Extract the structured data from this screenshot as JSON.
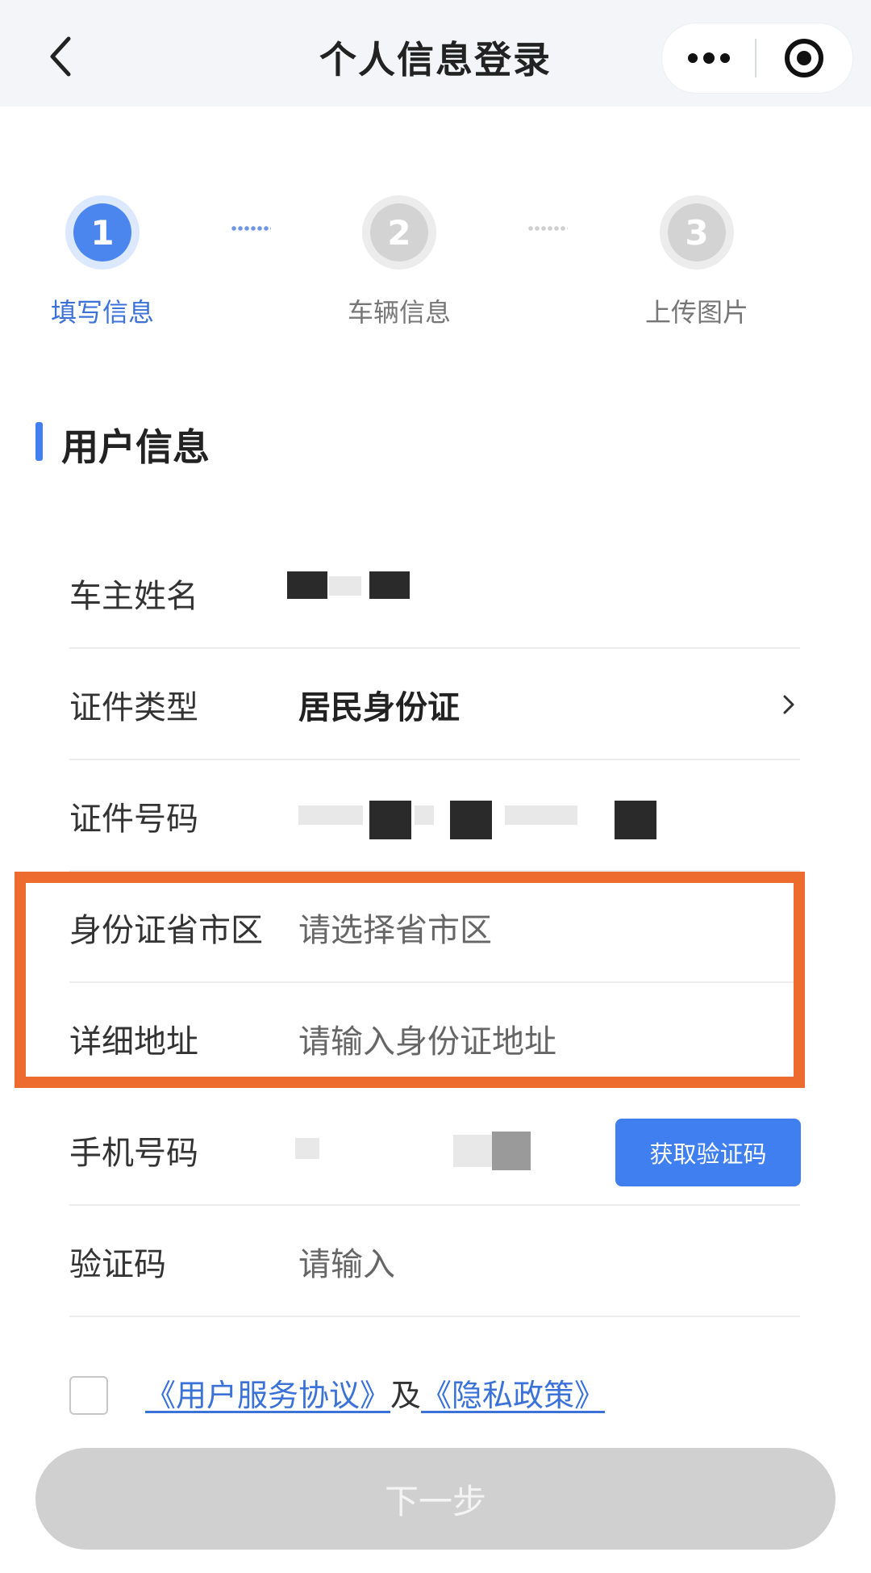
{
  "header": {
    "title": "个人信息登录"
  },
  "steps": [
    {
      "number": "1",
      "label": "填写信息",
      "state": "active"
    },
    {
      "number": "2",
      "label": "车辆信息",
      "state": "inactive"
    },
    {
      "number": "3",
      "label": "上传图片",
      "state": "inactive"
    }
  ],
  "section": {
    "title": "用户信息"
  },
  "form": {
    "owner_name_label": "车主姓名",
    "id_type_label": "证件类型",
    "id_type_value": "居民身份证",
    "id_number_label": "证件号码",
    "region_label": "身份证省市区",
    "region_placeholder": "请选择省市区",
    "address_label": "详细地址",
    "address_placeholder": "请输入身份证地址",
    "phone_label": "手机号码",
    "get_code_label": "获取验证码",
    "code_label": "验证码",
    "code_placeholder": "请输入"
  },
  "agreement": {
    "user_agreement": "《用户服务协议》",
    "and": "及",
    "privacy_policy": "《隐私政策》"
  },
  "next_button": "下一步",
  "colors": {
    "primary": "#3f7ff0",
    "highlight": "#ee6b2f",
    "disabled": "#d0d0d0"
  },
  "icons": [
    "back-chevron-icon",
    "more-dots-icon",
    "target-icon",
    "chevron-right-icon"
  ]
}
